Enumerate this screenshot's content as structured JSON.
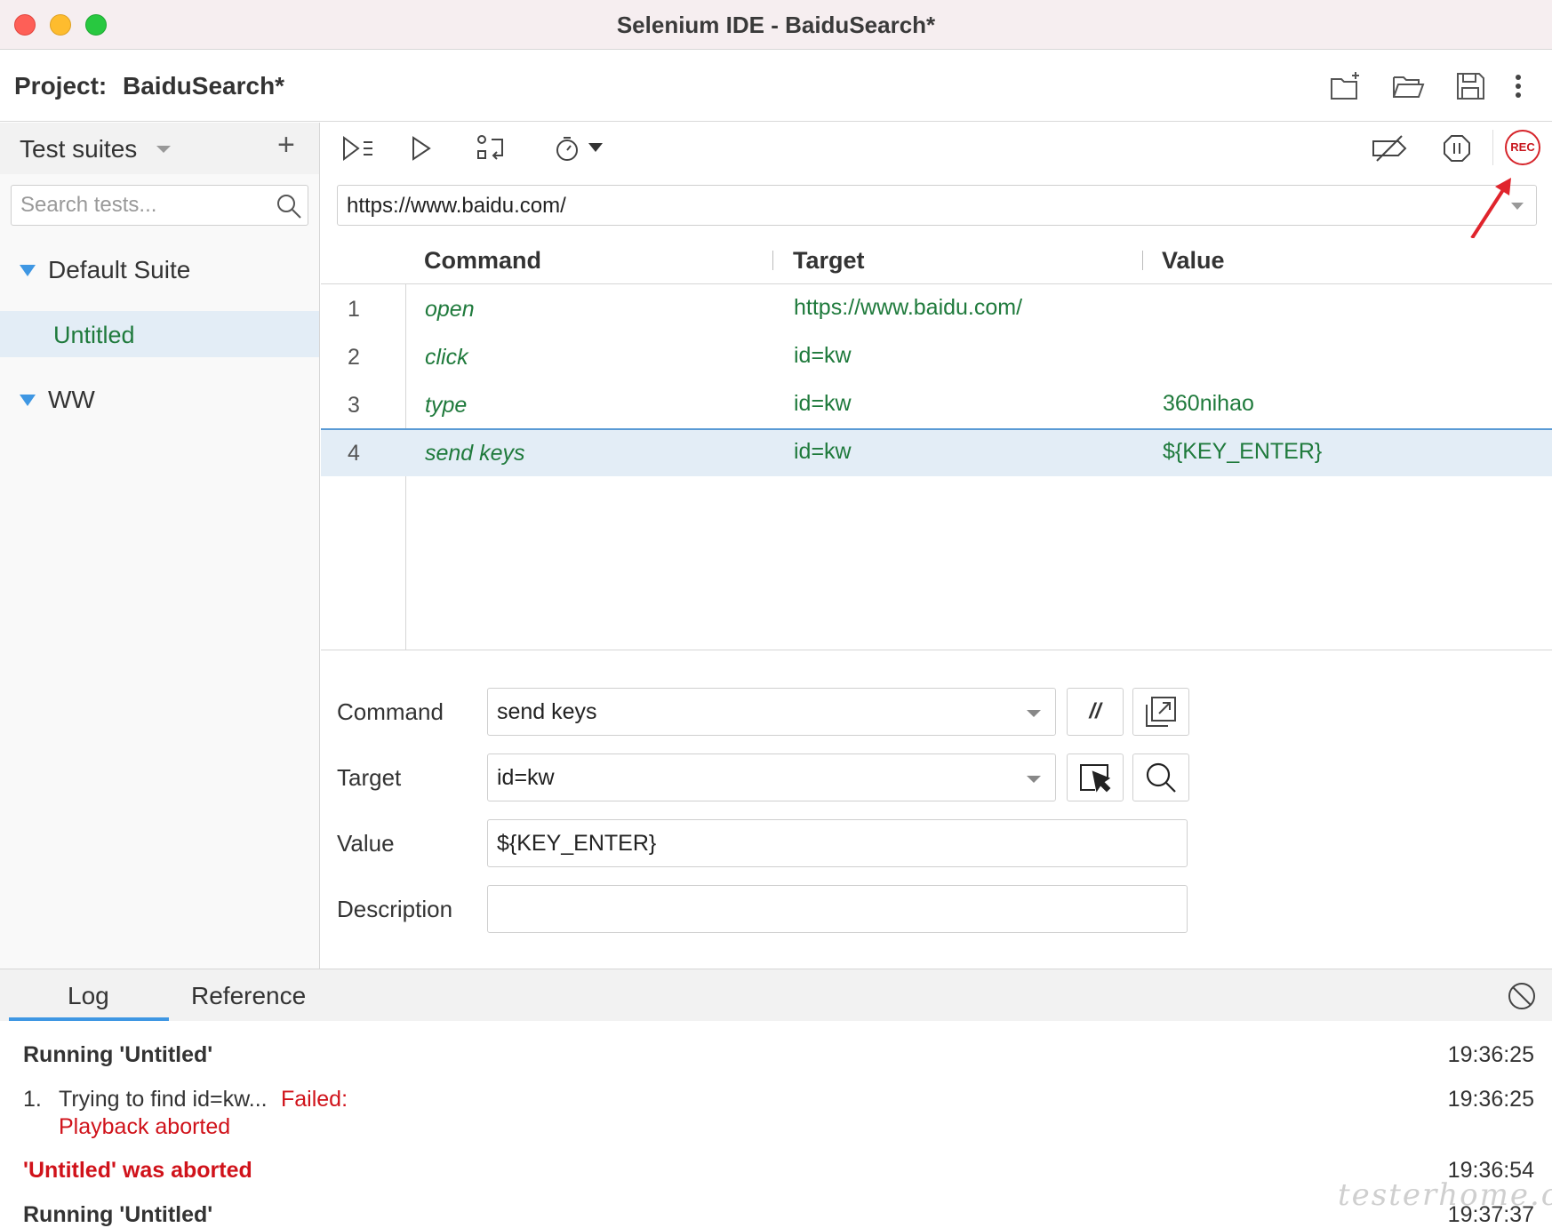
{
  "window": {
    "title": "Selenium IDE - BaiduSearch*"
  },
  "project": {
    "label": "Project:",
    "name": "BaiduSearch*"
  },
  "project_actions": [
    {
      "name": "new-project-icon"
    },
    {
      "name": "open-project-icon"
    },
    {
      "name": "save-project-icon"
    },
    {
      "name": "more-options-icon"
    }
  ],
  "sidebar": {
    "title": "Test suites",
    "add_label": "+",
    "search_placeholder": "Search tests...",
    "suites": [
      {
        "name": "Default Suite",
        "tests": [
          {
            "name": "Untitled",
            "selected": true
          }
        ]
      },
      {
        "name": "WW",
        "tests": []
      }
    ]
  },
  "toolbar": {
    "rec_label": "REC",
    "buttons": [
      "run-all-tests-icon",
      "run-current-test-icon",
      "step-over-icon",
      "speed-timer-icon",
      "disable-breakpoints-icon",
      "pause-on-exceptions-icon",
      "record-icon"
    ]
  },
  "url": {
    "value": "https://www.baidu.com/"
  },
  "table": {
    "headers": {
      "command": "Command",
      "target": "Target",
      "value": "Value"
    },
    "rows": [
      {
        "num": "1",
        "command": "open",
        "target": "https://www.baidu.com/",
        "value": ""
      },
      {
        "num": "2",
        "command": "click",
        "target": "id=kw",
        "value": ""
      },
      {
        "num": "3",
        "command": "type",
        "target": "id=kw",
        "value": "360nihao"
      },
      {
        "num": "4",
        "command": "send keys",
        "target": "id=kw",
        "value": "${KEY_ENTER}"
      }
    ]
  },
  "editor": {
    "command_label": "Command",
    "command_value": "send keys",
    "comment_label": "//",
    "target_label": "Target",
    "target_value": "id=kw",
    "value_label": "Value",
    "value_value": "${KEY_ENTER}",
    "description_label": "Description",
    "description_value": ""
  },
  "log": {
    "tabs": [
      "Log",
      "Reference"
    ],
    "entries": [
      {
        "text": "Running 'Untitled'",
        "time": "19:36:25"
      },
      {
        "prefix": "1.",
        "text": "Trying to find id=kw...",
        "status": "Failed:",
        "detail": "Playback aborted",
        "time": "19:36:25"
      },
      {
        "text": "'Untitled' was aborted",
        "time": "19:36:54"
      },
      {
        "text": "Running 'Untitled'",
        "time": "19:37:37"
      }
    ]
  },
  "watermark": "testerhome.com",
  "colors": {
    "accent_blue": "#3f97e3",
    "command_green": "#1f7a3c",
    "error_red": "#d0121a",
    "rec_red": "#d6242a",
    "selection": "#e3edf6"
  }
}
